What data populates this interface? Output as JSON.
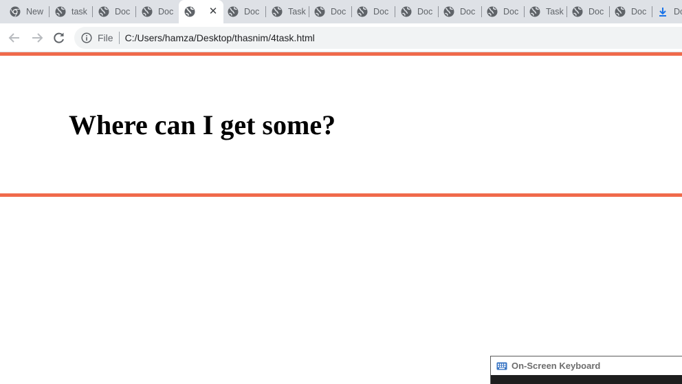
{
  "browser": {
    "tabs": [
      {
        "title": "New",
        "favicon": "chrome-icon"
      },
      {
        "title": "task",
        "favicon": "globe-icon"
      },
      {
        "title": "Doc",
        "favicon": "globe-icon"
      },
      {
        "title": "Doc",
        "favicon": "globe-icon"
      },
      {
        "title": "",
        "favicon": "globe-icon",
        "active": true
      },
      {
        "title": "Doc",
        "favicon": "globe-icon"
      },
      {
        "title": "Task",
        "favicon": "globe-icon"
      },
      {
        "title": "Doc",
        "favicon": "globe-icon"
      },
      {
        "title": "Doc",
        "favicon": "globe-icon"
      },
      {
        "title": "Doc",
        "favicon": "globe-icon"
      },
      {
        "title": "Doc",
        "favicon": "globe-icon"
      },
      {
        "title": "Doc",
        "favicon": "globe-icon"
      },
      {
        "title": "Task",
        "favicon": "globe-icon"
      },
      {
        "title": "Doc",
        "favicon": "globe-icon"
      },
      {
        "title": "Doc",
        "favicon": "globe-icon"
      },
      {
        "title": "Do",
        "favicon": "download-icon"
      }
    ],
    "close_glyph": "✕",
    "address_bar": {
      "chip_label": "File",
      "url": "C:/Users/hamza/Desktop/thasnim/4task.html"
    }
  },
  "page": {
    "heading": "Where can I get some?",
    "accent_color": "#f06a4b"
  },
  "osk": {
    "title": "On-Screen Keyboard"
  }
}
